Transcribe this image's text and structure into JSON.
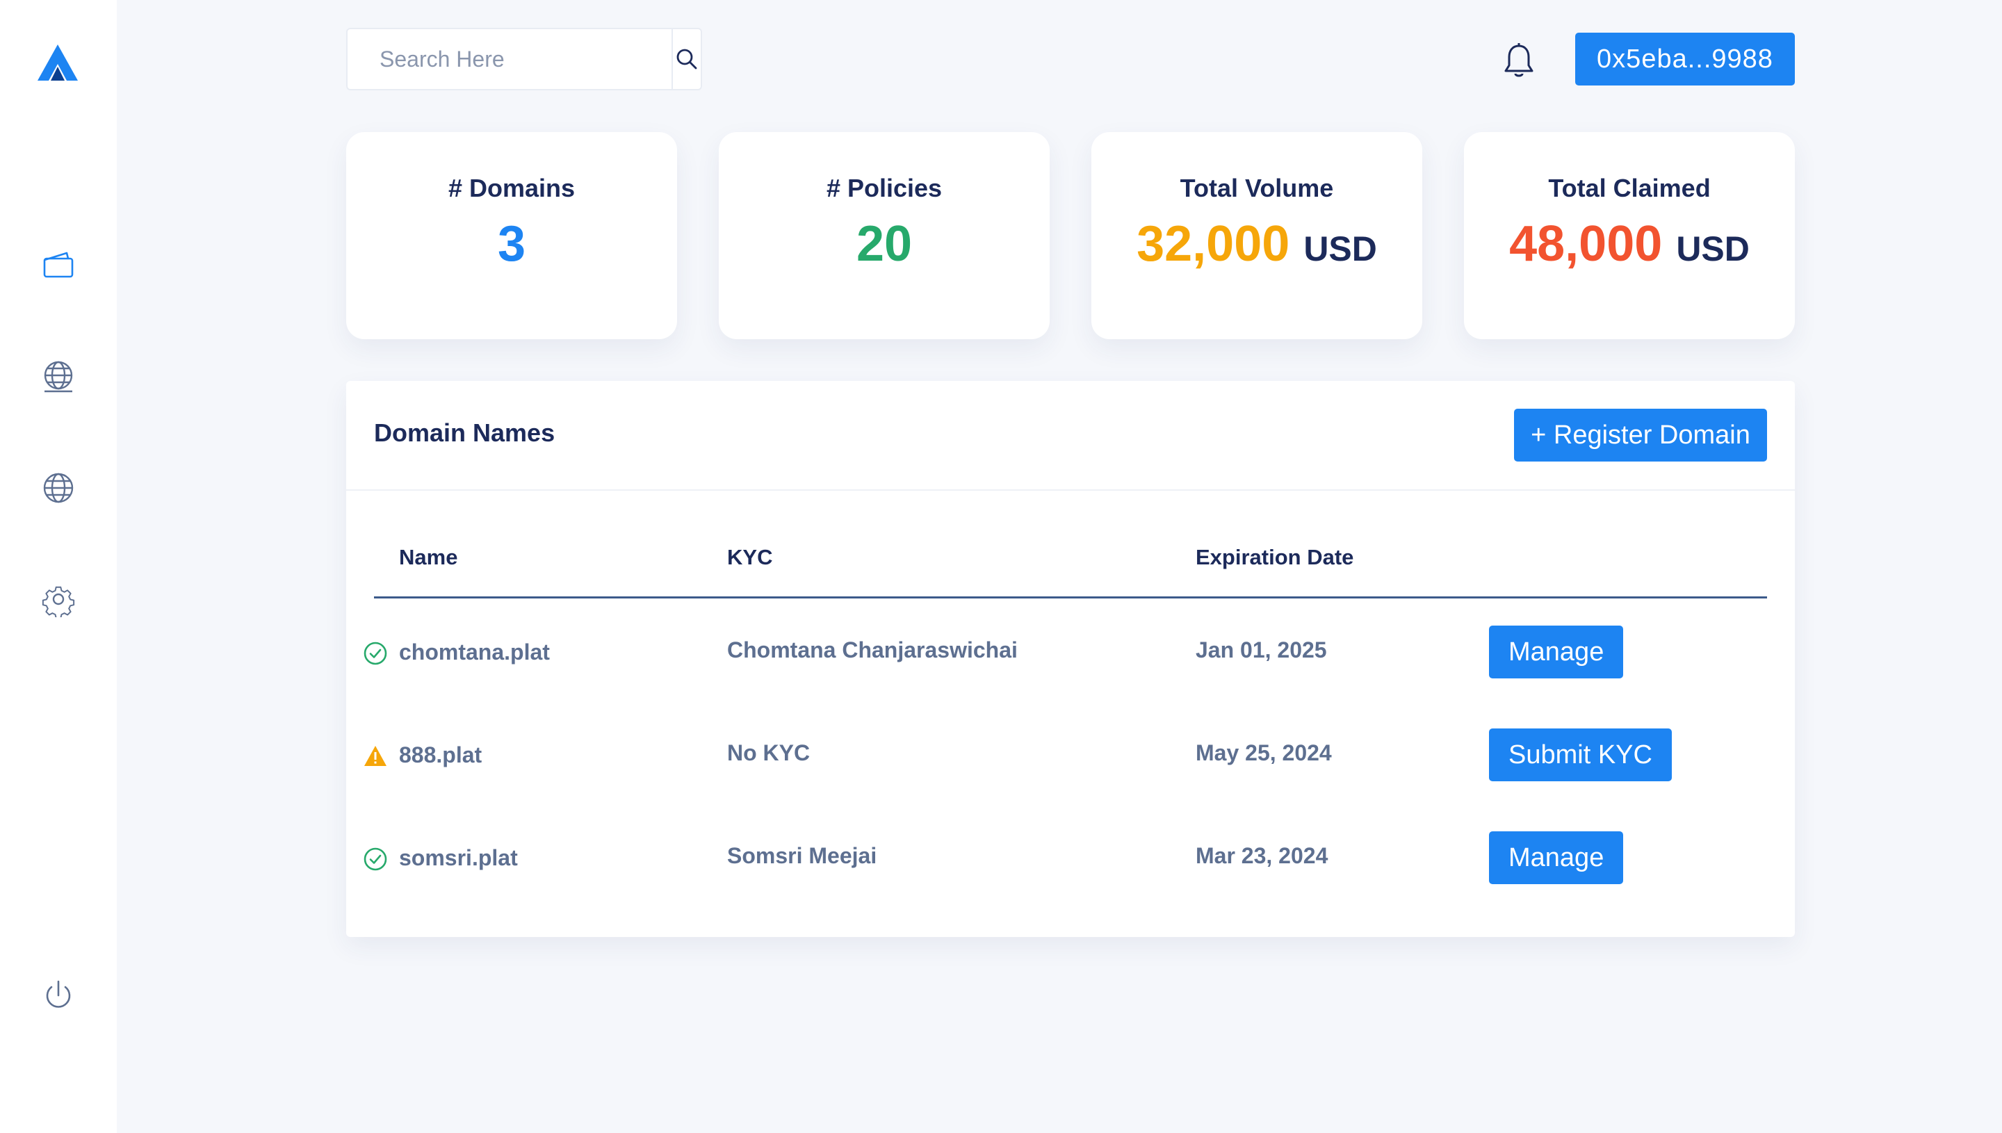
{
  "search": {
    "placeholder": "Search Here"
  },
  "wallet": {
    "address": "0x5eba...9988"
  },
  "stats": [
    {
      "title": "# Domains",
      "value": "3",
      "unit": "",
      "color": "#1d84f2"
    },
    {
      "title": "# Policies",
      "value": "20",
      "unit": "",
      "color": "#27a96b"
    },
    {
      "title": "Total Volume",
      "value": "32,000",
      "unit": "USD",
      "color": "#f6a609"
    },
    {
      "title": "Total Claimed",
      "value": "48,000",
      "unit": "USD",
      "color": "#f2532f"
    }
  ],
  "panel": {
    "title": "Domain Names",
    "register_label": "+ Register Domain",
    "columns": {
      "name": "Name",
      "kyc": "KYC",
      "expiration": "Expiration Date"
    },
    "rows": [
      {
        "status": "verified",
        "name": "chomtana.plat",
        "kyc": "Chomtana Chanjaraswichai",
        "expiration": "Jan 01, 2025",
        "action": "Manage"
      },
      {
        "status": "warning",
        "name": "888.plat",
        "kyc": "No KYC",
        "expiration": "May 25, 2024",
        "action": "Submit KYC"
      },
      {
        "status": "verified",
        "name": "somsri.plat",
        "kyc": "Somsri Meejai",
        "expiration": "Mar 23, 2024",
        "action": "Manage"
      }
    ]
  },
  "icons": {
    "logo": "brand-logo-icon",
    "nav": [
      "wallet-icon",
      "globe-domain-icon",
      "globe-icon",
      "gear-icon",
      "power-icon"
    ],
    "search": "search-icon",
    "bell": "bell-icon"
  },
  "colors": {
    "accent": "#1d84f2",
    "success": "#27a96b",
    "warning": "#f6a609",
    "danger": "#f2532f",
    "text_dark": "#1c2a5a",
    "text_muted": "#5d6f90"
  }
}
